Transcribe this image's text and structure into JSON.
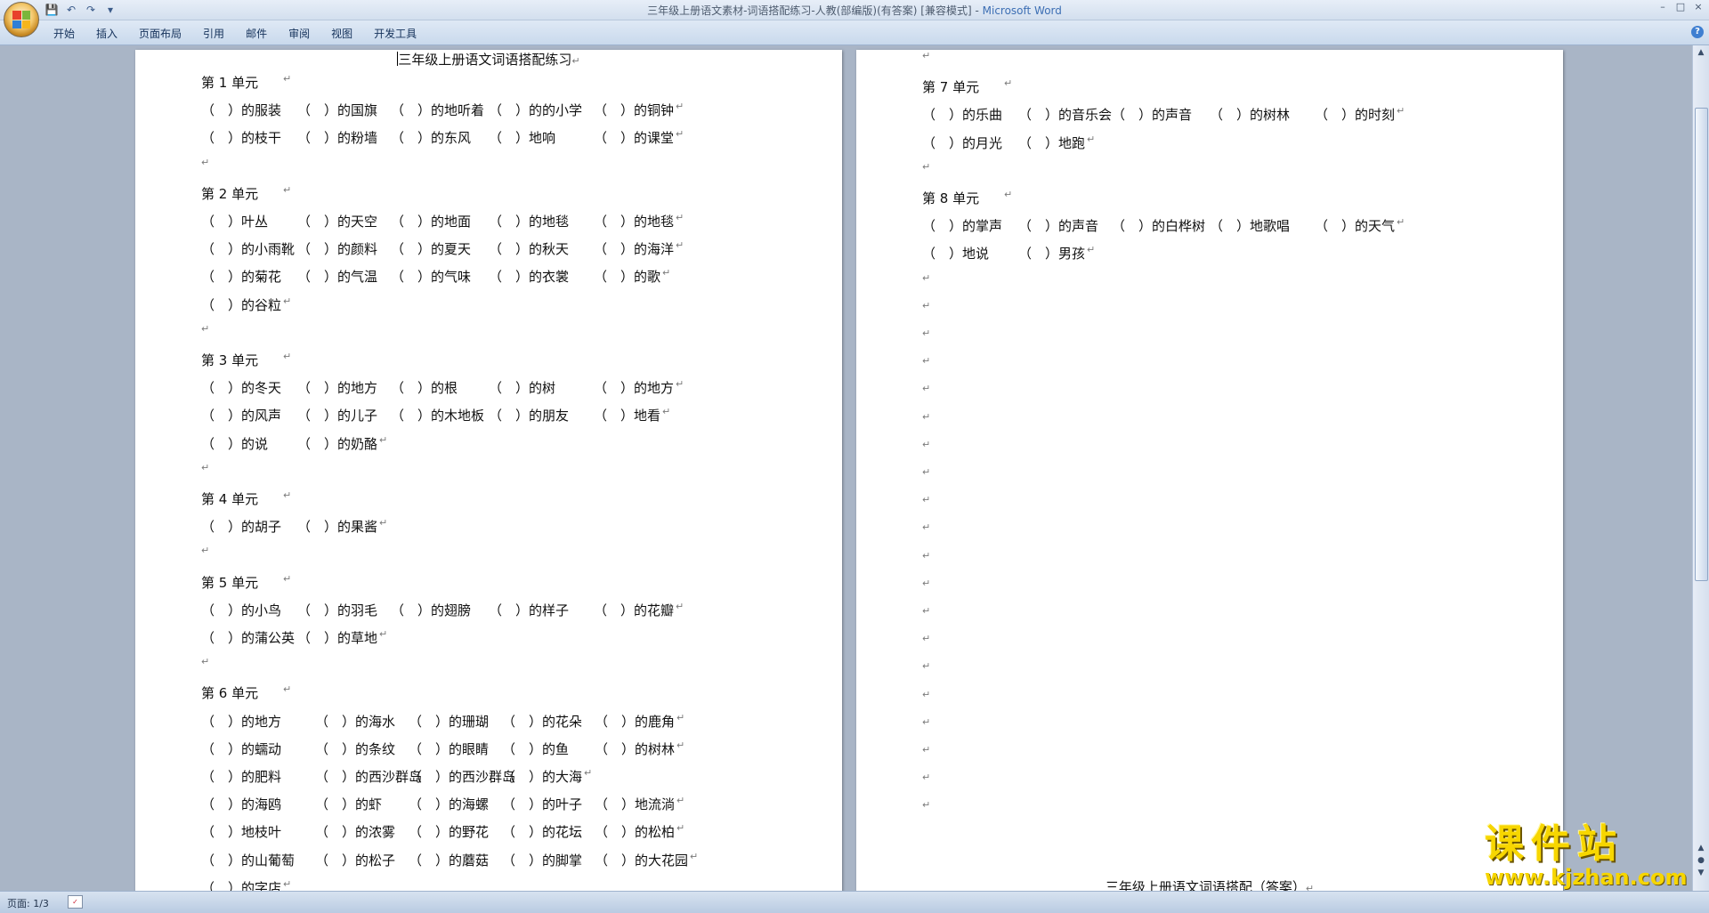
{
  "window": {
    "title": "三年级上册语文素材-词语搭配练习-人教(部编版)(有答案) [兼容模式] - ",
    "app_name": "Microsoft Word",
    "controls": [
      "–",
      "□",
      "×"
    ]
  },
  "qat": [
    "💾",
    "↶",
    "↷",
    "▾"
  ],
  "tabs": [
    "开始",
    "插入",
    "页面布局",
    "引用",
    "邮件",
    "审阅",
    "视图",
    "开发工具"
  ],
  "help": "?",
  "pilcrow": "↵",
  "left_page": {
    "title": "三年级上册语文词语搭配练习",
    "lines": [
      {
        "cells": [
          "第 1 单元"
        ]
      },
      {
        "cells": [
          "（　）的服装",
          "（　）的国旗",
          "（　）的地听着",
          "（　）的的小学",
          "（　）的铜钟"
        ]
      },
      {
        "cells": [
          "（　）的枝干",
          "（　）的粉墙",
          "（　）的东风",
          "（　）地响",
          "（　）的课堂"
        ]
      },
      {
        "cells": []
      },
      {
        "cells": [
          "第 2 单元"
        ]
      },
      {
        "cells": [
          "（　）叶丛",
          "（　）的天空",
          "（　）的地面",
          "（　）的地毯",
          "（　）的地毯"
        ]
      },
      {
        "cells": [
          "（　）的小雨靴",
          "（　）的颜料",
          "（　）的夏天",
          "（　）的秋天",
          "（　）的海洋"
        ]
      },
      {
        "cells": [
          "（　）的菊花",
          "（　）的气温",
          "（　）的气味",
          "（　）的衣裳",
          "（　）的歌"
        ]
      },
      {
        "cells": [
          "（　）的谷粒"
        ]
      },
      {
        "cells": []
      },
      {
        "cells": [
          "第 3 单元"
        ]
      },
      {
        "cells": [
          "（　）的冬天",
          "（　）的地方",
          "（　）的根",
          "（　）的树",
          "（　）的地方"
        ]
      },
      {
        "cells": [
          "（　）的风声",
          "（　）的儿子",
          "（　）的木地板",
          "（　）的朋友",
          "（　）地看"
        ]
      },
      {
        "cells": [
          "（　）的说",
          "（　）的奶酪"
        ]
      },
      {
        "cells": []
      },
      {
        "cells": [
          "第 4 单元"
        ]
      },
      {
        "cells": [
          "（　）的胡子",
          "（　）的果酱"
        ]
      },
      {
        "cells": []
      },
      {
        "cells": [
          "第 5 单元"
        ]
      },
      {
        "cells": [
          "（　）的小鸟",
          "（　）的羽毛",
          "（　）的翅膀",
          "（　）的样子",
          "（　）的花瓣"
        ]
      },
      {
        "cells": [
          "（　）的蒲公英",
          "（　）的草地"
        ]
      },
      {
        "cells": []
      },
      {
        "cells": [
          "第 6 单元"
        ]
      },
      {
        "cells": [
          "（　）的地方",
          "（　）的海水",
          "（　）的珊瑚",
          "（　）的花朵",
          "（　）的鹿角"
        ]
      },
      {
        "cells": [
          "（　）的蠕动",
          "（　）的条纹",
          "（　）的眼睛",
          "（　）的鱼",
          "（　）的树林"
        ]
      },
      {
        "cells": [
          "（　）的肥料",
          "（　）的西沙群岛",
          "（　）的西沙群岛",
          "（　）的大海"
        ]
      },
      {
        "cells": [
          "（　）的海鸥",
          "（　）的虾",
          "（　）的海螺",
          "（　）的叶子",
          "（　）地流淌"
        ]
      },
      {
        "cells": [
          "（　）地枝叶",
          "（　）的浓雾",
          "（　）的野花",
          "（　）的花坛",
          "（　）的松柏"
        ]
      },
      {
        "cells": [
          "（　）的山葡萄",
          "（　）的松子",
          "（　）的蘑菇",
          "（　）的脚掌",
          "（　）的大花园"
        ]
      },
      {
        "cells": [
          "（　）的字店"
        ]
      }
    ]
  },
  "right_page": {
    "lines": [
      {
        "cells": []
      },
      {
        "cells": [
          "第 7 单元"
        ]
      },
      {
        "cells": [
          "（　）的乐曲",
          "（　）的音乐会",
          "（　）的声音",
          "（　）的树林",
          "（　）的时刻"
        ]
      },
      {
        "cells": [
          "（　）的月光",
          "（　）地跑"
        ]
      },
      {
        "cells": []
      },
      {
        "cells": [
          "第 8 单元"
        ]
      },
      {
        "cells": [
          "（　）的掌声",
          "（　）的声音",
          "（　）的白桦树",
          "（　）地歌唱",
          "（　）的天气"
        ]
      },
      {
        "cells": [
          "（　）地说",
          "（　）男孩"
        ]
      },
      {
        "cells": []
      },
      {
        "cells": []
      },
      {
        "cells": []
      },
      {
        "cells": []
      },
      {
        "cells": []
      },
      {
        "cells": []
      },
      {
        "cells": []
      },
      {
        "cells": []
      },
      {
        "cells": []
      },
      {
        "cells": []
      },
      {
        "cells": []
      },
      {
        "cells": []
      },
      {
        "cells": []
      },
      {
        "cells": []
      },
      {
        "cells": []
      },
      {
        "cells": []
      },
      {
        "cells": []
      },
      {
        "cells": []
      },
      {
        "cells": []
      },
      {
        "cells": []
      }
    ],
    "footer_title": "三年级上册语文词语搭配（答案）"
  },
  "status": {
    "page_info": "页面: 1/3"
  },
  "watermark": {
    "brand": "课件站",
    "url": "www.kjzhan.com"
  }
}
